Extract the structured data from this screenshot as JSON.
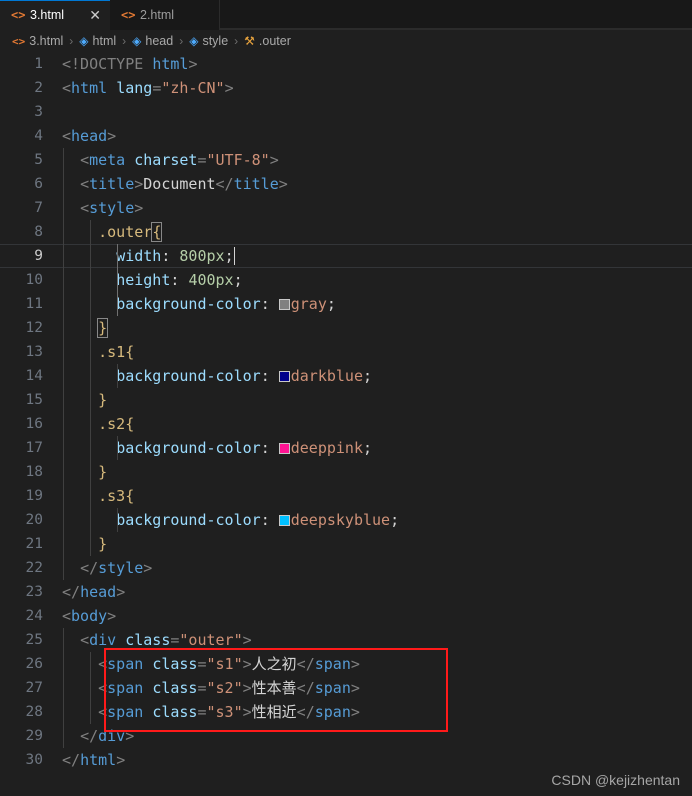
{
  "tabs": [
    {
      "label": "3.html",
      "icon": "html-file-icon",
      "active": true,
      "close": "✕"
    },
    {
      "label": "2.html",
      "icon": "html-file-icon",
      "active": false
    }
  ],
  "breadcrumb": [
    {
      "label": "3.html",
      "icon": "code-icon"
    },
    {
      "label": "html",
      "icon": "cube-icon"
    },
    {
      "label": "head",
      "icon": "cube-icon"
    },
    {
      "label": "style",
      "icon": "cube-icon"
    },
    {
      "label": ".outer",
      "icon": "ruler-icon"
    }
  ],
  "breadcrumb_separator": "›",
  "editor": {
    "active_line": 9,
    "cursor_line": 9,
    "line_numbers": [
      1,
      2,
      3,
      4,
      5,
      6,
      7,
      8,
      9,
      10,
      11,
      12,
      13,
      14,
      15,
      16,
      17,
      18,
      19,
      20,
      21,
      22,
      23,
      24,
      25,
      26,
      27,
      28,
      29,
      30
    ],
    "lines": [
      {
        "n": 1,
        "text": "<!DOCTYPE html>"
      },
      {
        "n": 2,
        "text": "<html lang=\"zh-CN\">"
      },
      {
        "n": 3,
        "text": ""
      },
      {
        "n": 4,
        "text": "<head>"
      },
      {
        "n": 5,
        "text": "  <meta charset=\"UTF-8\">"
      },
      {
        "n": 6,
        "text": "  <title>Document</title>"
      },
      {
        "n": 7,
        "text": "  <style>"
      },
      {
        "n": 8,
        "text": "    .outer{"
      },
      {
        "n": 9,
        "text": "      width: 800px;"
      },
      {
        "n": 10,
        "text": "      height: 400px;"
      },
      {
        "n": 11,
        "text": "      background-color: gray;"
      },
      {
        "n": 12,
        "text": "    }"
      },
      {
        "n": 13,
        "text": "    .s1{"
      },
      {
        "n": 14,
        "text": "      background-color: darkblue;"
      },
      {
        "n": 15,
        "text": "    }"
      },
      {
        "n": 16,
        "text": "    .s2{"
      },
      {
        "n": 17,
        "text": "      background-color: deeppink;"
      },
      {
        "n": 18,
        "text": "    }"
      },
      {
        "n": 19,
        "text": "    .s3{"
      },
      {
        "n": 20,
        "text": "      background-color: deepskyblue;"
      },
      {
        "n": 21,
        "text": "    }"
      },
      {
        "n": 22,
        "text": "  </style>"
      },
      {
        "n": 23,
        "text": "</head>"
      },
      {
        "n": 24,
        "text": "<body>"
      },
      {
        "n": 25,
        "text": "  <div class=\"outer\">"
      },
      {
        "n": 26,
        "text": "    <span class=\"s1\">人之初</span>"
      },
      {
        "n": 27,
        "text": "    <span class=\"s2\">性本善</span>"
      },
      {
        "n": 28,
        "text": "    <span class=\"s3\">性相近</span>"
      },
      {
        "n": 29,
        "text": "  </div>"
      },
      {
        "n": 30,
        "text": "</html>"
      }
    ],
    "tokens": {
      "doctype": "<!DOCTYPE",
      "doctype_name": "html",
      "gt": ">",
      "lt": "<",
      "lt_slash": "</",
      "tag_html": "html",
      "attr_lang": "lang",
      "eq": "=",
      "str_zhcn": "\"zh-CN\"",
      "tag_head": "head",
      "tag_meta": "meta",
      "attr_charset": "charset",
      "str_utf8": "\"UTF-8\"",
      "tag_title": "title",
      "text_document": "Document",
      "tag_style": "style",
      "tag_body": "body",
      "tag_div": "div",
      "tag_span": "span",
      "attr_class": "class",
      "str_outer": "\"outer\"",
      "str_s1": "\"s1\"",
      "str_s2": "\"s2\"",
      "str_s3": "\"s3\"",
      "sel_outer": ".outer",
      "sel_s1": ".s1",
      "sel_s2": ".s2",
      "sel_s3": ".s3",
      "brace_open": "{",
      "brace_close": "}",
      "prop_width": "width",
      "prop_height": "height",
      "prop_bgcolor": "background-color",
      "colon": ":",
      "semicolon": ";",
      "val_800px": "800px",
      "val_400px": "400px",
      "val_gray": "gray",
      "val_darkblue": "darkblue",
      "val_deeppink": "deeppink",
      "val_deepskyblue": "deepskyblue",
      "cn_1": "人之初",
      "cn_2": "性本善",
      "cn_3": "性相近"
    },
    "color_swatches": {
      "gray": "#808080",
      "darkblue": "#00008b",
      "deeppink": "#ff1493",
      "deepskyblue": "#00bfff"
    }
  },
  "annotation": {
    "type": "red-rectangle",
    "color": "#ff1a1a",
    "covers_lines": [
      26,
      27,
      28
    ]
  },
  "watermark": "CSDN @kejizhentan",
  "theme": {
    "editor_bg": "#1f1f1f",
    "tabbar_bg": "#181818",
    "active_tab_bg": "#1f1f1f",
    "accent": "#0078d4",
    "line_number": "#6e7681"
  }
}
